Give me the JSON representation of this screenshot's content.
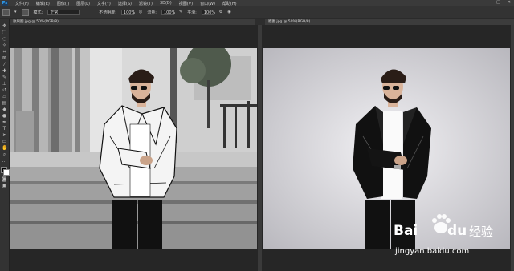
{
  "app": {
    "logo": "Ps"
  },
  "menu": [
    "文件(F)",
    "编辑(E)",
    "图像(I)",
    "图层(L)",
    "文字(Y)",
    "选择(S)",
    "滤镜(T)",
    "3D(D)",
    "视图(V)",
    "窗口(W)",
    "帮助(H)"
  ],
  "window_controls": [
    "—",
    "□",
    "✕"
  ],
  "options": {
    "mode_label": "模式:",
    "mode_value": "正常",
    "opacity_label": "不透明度:",
    "opacity_value": "100%",
    "flow_label": "流量:",
    "flow_value": "100%",
    "smooth_label": "平滑:",
    "smooth_value": "100%"
  },
  "tabs": {
    "left": "效果图.jpg @ 50%(RGB/8)",
    "right": "原图.jpg @ 50%(RGB/8)"
  },
  "watermark": {
    "brand": "Bai",
    "brand2": "du",
    "product": "经验",
    "url": "jingyan.baidu.com"
  }
}
